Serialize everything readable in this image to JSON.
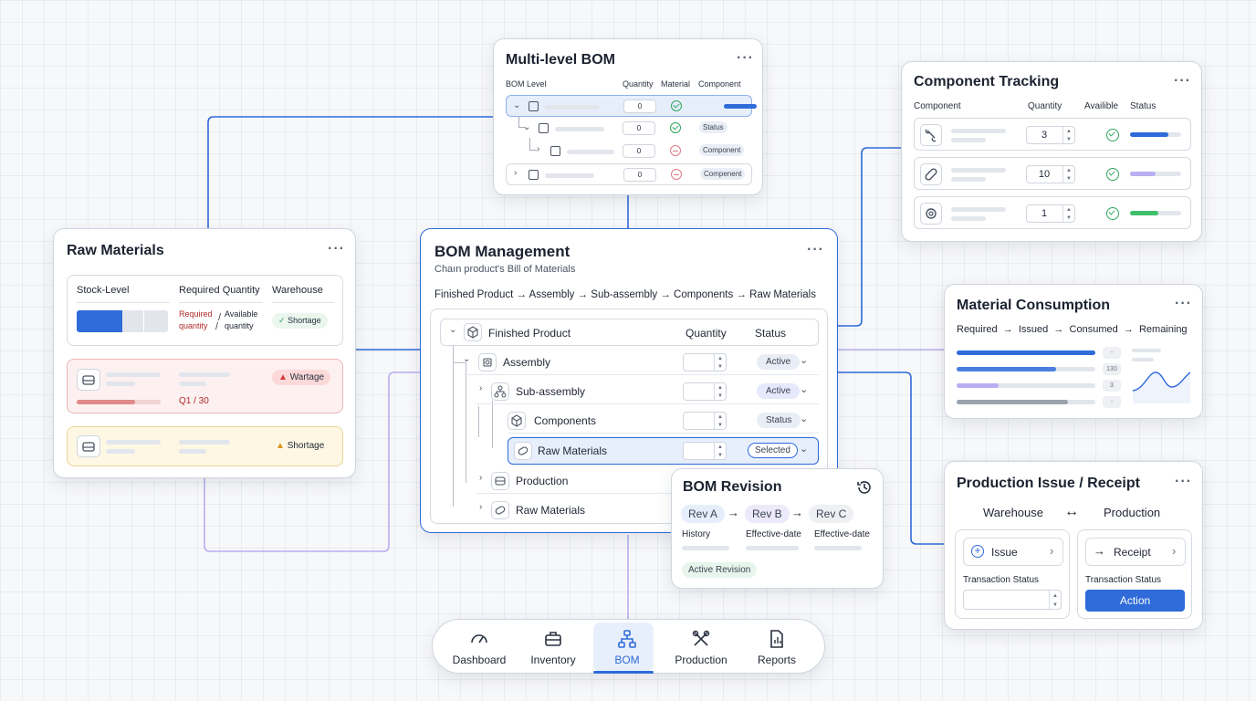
{
  "multilevel_bom": {
    "title": "Multi-level BOM",
    "headers": {
      "level": "BOM Level",
      "quantity": "Quantity",
      "material": "Material",
      "component": "Component"
    },
    "rows": [
      {
        "qty": "0",
        "status": "ok",
        "tag": ""
      },
      {
        "qty": "0",
        "status": "ok",
        "tag": "Status"
      },
      {
        "qty": "0",
        "status": "warn",
        "tag": "Component"
      },
      {
        "qty": "0",
        "status": "warn",
        "tag": "Compenent"
      }
    ]
  },
  "component_tracking": {
    "title": "Component Tracking",
    "headers": {
      "component": "Component",
      "quantity": "Quantity",
      "available": "Availible",
      "status": "Status"
    },
    "rows": [
      {
        "icon": "wrench-icon",
        "qty": "3",
        "color": "#2f6bd9",
        "fill": 0.75
      },
      {
        "icon": "bandage-icon",
        "qty": "10",
        "color": "#b9aef0",
        "fill": 0.5
      },
      {
        "icon": "gear-icon",
        "qty": "1",
        "color": "#3fbf6b",
        "fill": 0.55
      }
    ]
  },
  "raw_materials": {
    "title": "Raw Materials",
    "headers": {
      "stock": "Stock-Level",
      "required": "Required Quantity",
      "warehouse": "Warehouse"
    },
    "required_word": "Required",
    "quantity_word": "quantity",
    "available_word": "Available",
    "available_quantity_word": "quantity",
    "badge_shortage": "Shortage",
    "badge_wartage": "Wartage",
    "badge_shortage2": "Shortage",
    "ratio": "Q1 / 30",
    "stock_fill": 0.5
  },
  "bom_management": {
    "title": "BOM Management",
    "subtitle": "Chaın product's Bill of Materials",
    "breadcrumb": "Finished Product → Assembly → Sub-assembly → Components → Raw Materials",
    "headers": {
      "quantity": "Quantity",
      "status": "Status"
    },
    "rows": [
      {
        "label": "Finished Product",
        "status": "",
        "icon": "cube-icon"
      },
      {
        "label": "Assembly",
        "status": "Active",
        "icon": "assembly-icon"
      },
      {
        "label": "Sub-assembly",
        "status": "Active",
        "icon": "hierarchy-icon"
      },
      {
        "label": "Components",
        "status": "Status",
        "icon": "cube-icon"
      },
      {
        "label": "Raw Materials",
        "status": "Selected",
        "icon": "material-icon"
      },
      {
        "label": "Production",
        "status": "",
        "icon": "tray-icon"
      },
      {
        "label": "Raw Materials",
        "status": "",
        "icon": "material-icon"
      }
    ]
  },
  "bom_revision": {
    "title": "BOM Revision",
    "revisions": [
      "Rev A",
      "Rev B",
      "Rev C"
    ],
    "cols": [
      "History",
      "Effective-date",
      "Effective-date"
    ],
    "badge": "Active Revision"
  },
  "material_consumption": {
    "title": "Material Consumption",
    "flow": [
      "Required",
      "Issued",
      "Consumed",
      "Remaining"
    ],
    "bars": [
      {
        "color": "#2f6bd9",
        "fill": 1.0,
        "tag": "-"
      },
      {
        "color": "#4a7fe0",
        "fill": 0.72,
        "tag": "130"
      },
      {
        "color": "#b9aef0",
        "fill": 0.3,
        "tag": "3"
      },
      {
        "color": "#9aa2ae",
        "fill": 0.8,
        "tag": "-"
      }
    ]
  },
  "production_issue": {
    "title": "Production Issue / Receipt",
    "left_label": "Warehouse",
    "swap_symbol": "↔",
    "right_label": "Production",
    "issue": "Issue",
    "receipt": "Receipt",
    "txn_status_left": "Transaction Status",
    "txn_status_right": "Transaction Status",
    "action": "Action"
  },
  "nav": {
    "items": [
      "Dashboard",
      "Inventory",
      "BOM",
      "Production",
      "Reports"
    ],
    "active": "BOM"
  },
  "colors": {
    "accent": "#2f6bd9",
    "ok": "#2fa65a",
    "warn": "#e07a86"
  }
}
